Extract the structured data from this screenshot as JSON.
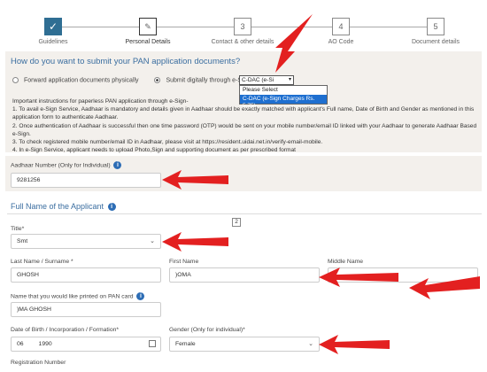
{
  "stepper": {
    "steps": [
      {
        "num": "",
        "label": "Guidelines"
      },
      {
        "num": "",
        "label": "Personal Details"
      },
      {
        "num": "3",
        "label": "Contact & other details"
      },
      {
        "num": "4",
        "label": "AO Code"
      },
      {
        "num": "5",
        "label": "Document details"
      }
    ]
  },
  "question": {
    "title": "How do you want to submit your PAN application documents?",
    "option_physical": "Forward application documents physically",
    "option_digital": "Submit digitally through e-Sign",
    "esign_select_value": "C-DAC (e-Si",
    "esign_options": [
      "Please Select",
      "C-DAC (e-Sign Charges Rs. 5.75)"
    ]
  },
  "instructions": [
    "Important instructions for paperless PAN application through e-Sign-",
    "1. To avail e-Sign Service, Aadhaar is mandatory and details given in Aadhaar should be exactly matched with applicant's Full name, Date of Birth and Gender as mentioned in this application form to authenticate Aadhaar.",
    "2. Once authentication of Aadhaar is successful then one time password (OTP) would be sent on your mobile number/email ID linked with your Aadhaar to generate Aadhaar Based e-Sign.",
    "3. To check registered mobile number/email ID in Aadhaar, please visit at https://resident.uidai.net.in/verify-email-mobile.",
    "4. In e-Sign Service, applicant needs to upload Photo,Sign and supporting document as per prescribed format"
  ],
  "aadhaar": {
    "label": "Aadhaar Number (Only for Individual)",
    "value": "9281256"
  },
  "full_name": {
    "section_title": "Full Name of the Applicant",
    "badge": "2",
    "title_label": "Title*",
    "title_value": "Smt",
    "last_name_label": "Last Name / Surname *",
    "last_name_value": "GHOSH",
    "first_name_label": "First Name",
    "first_name_value": ")OMA",
    "middle_name_label": "Middle Name",
    "middle_name_value": "",
    "print_name_label": "Name that you would like printed on PAN card",
    "print_name_value": ")MA GHOSH",
    "dob_label": "Date of Birth / Incorporation / Formation*",
    "dob_value": "06         1990",
    "gender_label": "Gender (Only for individual)*",
    "gender_value": "Female",
    "registration_label": "Registration Number"
  },
  "colors": {
    "accent": "#3b6ea0",
    "arrow": "#e32020",
    "band": "#f3f0ec"
  },
  "icons": [
    "check-icon",
    "edit-icon",
    "info-icon",
    "calendar-icon",
    "chevron-down-icon",
    "red-arrow-icon"
  ]
}
